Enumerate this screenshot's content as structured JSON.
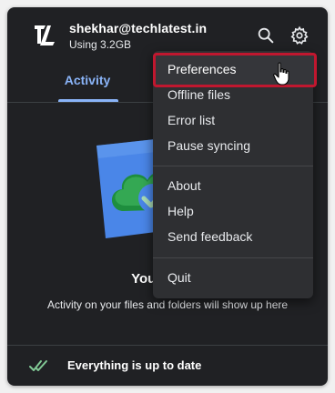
{
  "account": {
    "email": "shekhar@techlatest.in",
    "usage": "Using 3.2GB"
  },
  "icons": {
    "logo": "techlatest-logo-icon",
    "search": "search-icon",
    "settings": "gear-icon",
    "status": "double-check-icon",
    "cursor": "hand-pointer-icon"
  },
  "tabs": {
    "activity": "Activity"
  },
  "empty_state": {
    "title": "Your files a",
    "message": "Activity on your files and folders will show up here"
  },
  "status": {
    "text": "Everything is up to date"
  },
  "menu": {
    "items": [
      {
        "label": "Preferences"
      },
      {
        "label": "Offline files"
      },
      {
        "label": "Error list"
      },
      {
        "label": "Pause syncing"
      },
      {
        "label": "About"
      },
      {
        "label": "Help"
      },
      {
        "label": "Send feedback"
      },
      {
        "label": "Quit"
      }
    ]
  },
  "colors": {
    "accent": "#8ab4f8",
    "highlight_border": "#c0172f",
    "panel_bg": "#202124",
    "menu_bg": "#2e2f32",
    "check_green": "#81c995"
  }
}
